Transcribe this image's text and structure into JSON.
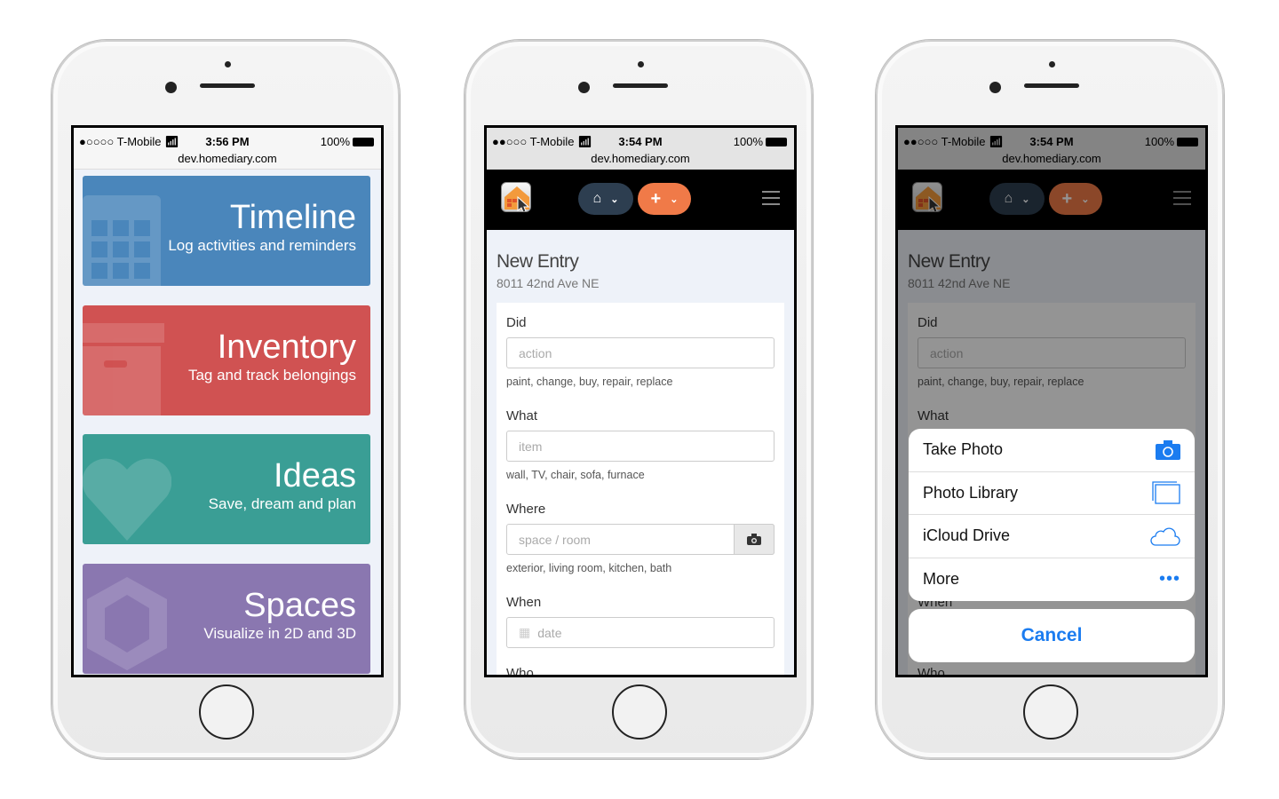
{
  "status": {
    "carrier": "T-Mobile",
    "battery": "100%",
    "url": "dev.homediary.com",
    "time1": "3:56 PM",
    "time2": "3:54 PM",
    "time3": "3:54 PM",
    "signal1": "●○○○○",
    "signal2": "●●○○○"
  },
  "menu": {
    "tiles": [
      {
        "title": "Timeline",
        "subtitle": "Log activities and reminders",
        "color": "#4a86bb",
        "icon": "calendar-icon"
      },
      {
        "title": "Inventory",
        "subtitle": "Tag and track belongings",
        "color": "#d05252",
        "icon": "archive-box-icon"
      },
      {
        "title": "Ideas",
        "subtitle": "Save, dream and plan",
        "color": "#3a9e95",
        "icon": "heart-icon"
      },
      {
        "title": "Spaces",
        "subtitle": "Visualize in 2D and 3D",
        "color": "#8a77b0",
        "icon": "cube-icon"
      }
    ]
  },
  "nav": {
    "home_color": "#2d3e50",
    "add_color": "#f07a48"
  },
  "form": {
    "title": "New Entry",
    "address": "8011 42nd Ave NE",
    "fields": [
      {
        "label": "Did",
        "placeholder": "action",
        "help": "paint, change, buy, repair, replace"
      },
      {
        "label": "What",
        "placeholder": "item",
        "help": "wall, TV, chair, sofa, furnace"
      },
      {
        "label": "Where",
        "placeholder": "space / room",
        "help": "exterior, living room, kitchen, bath"
      },
      {
        "label": "When",
        "placeholder": "date"
      },
      {
        "label": "Who"
      }
    ]
  },
  "sheet": {
    "options": [
      {
        "label": "Take Photo",
        "icon": "camera-icon"
      },
      {
        "label": "Photo Library",
        "icon": "photo-library-icon"
      },
      {
        "label": "iCloud Drive",
        "icon": "cloud-icon"
      },
      {
        "label": "More",
        "icon": "more-icon"
      }
    ],
    "cancel": "Cancel",
    "accent": "#1b7cf0"
  }
}
